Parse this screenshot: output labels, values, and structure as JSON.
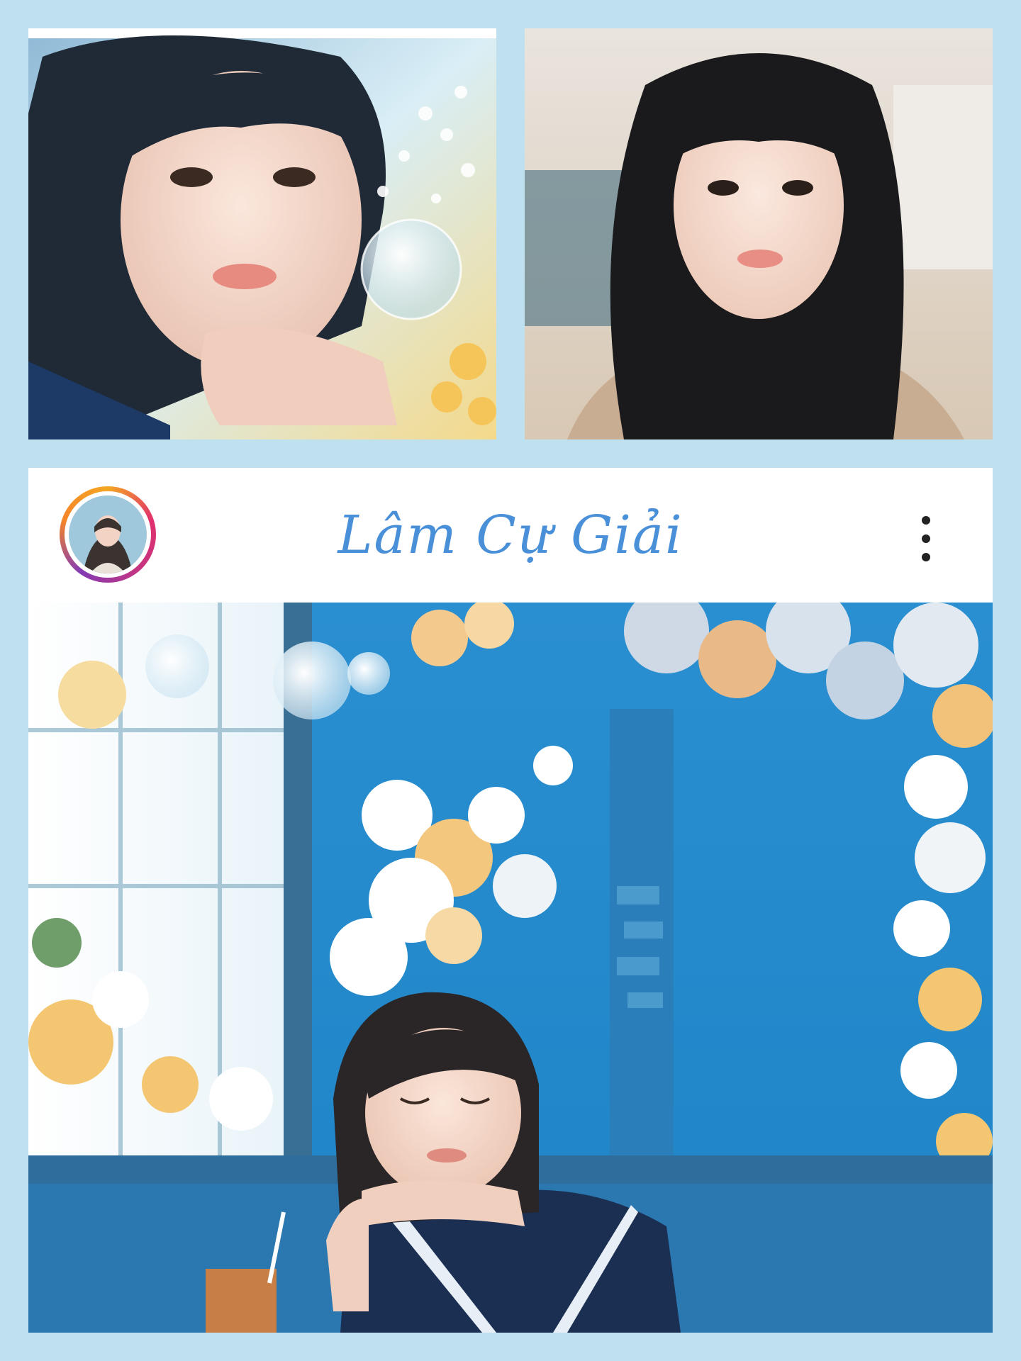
{
  "collage": {
    "photos": [
      {
        "icon": "portrait-photo-crystal-ball"
      },
      {
        "icon": "portrait-photo-long-hair"
      }
    ]
  },
  "post": {
    "username": "Lâm Cự Giải",
    "avatar_icon": "profile-avatar-icon",
    "more_icon": "more-vertical-icon",
    "photo_icon": "post-photo-sleeping-girl"
  },
  "colors": {
    "background": "#bfe0ee",
    "username": "#4a90d9",
    "wall_blue": "#1e84c7"
  }
}
